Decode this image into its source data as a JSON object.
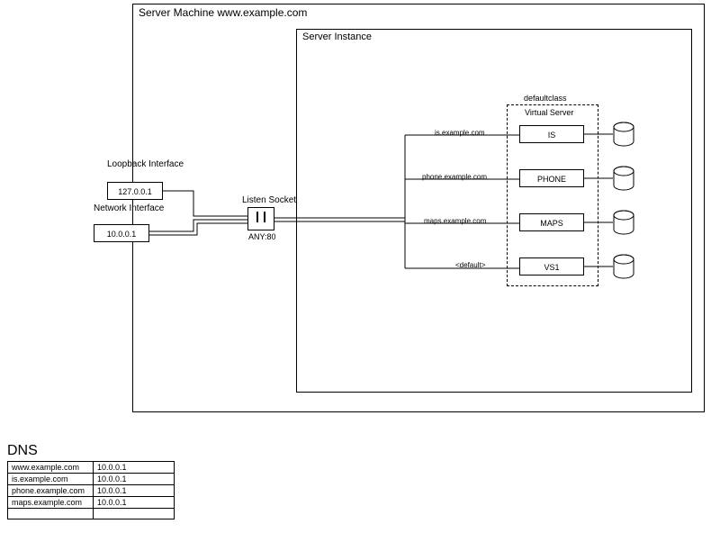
{
  "server_machine": {
    "title": "Server Machine www.example.com"
  },
  "server_instance": {
    "title": "Server Instance"
  },
  "loopback": {
    "label": "Loopback Interface",
    "ip": "127.0.0.1"
  },
  "network": {
    "label": "Network Interface",
    "ip": "10.0.0.1"
  },
  "listen_socket": {
    "label": "Listen Socket",
    "value": "ANY:80"
  },
  "defaultclass": {
    "label": "defaultclass",
    "inner_label": "Virtual Server"
  },
  "vs": [
    {
      "host": "is.example.com",
      "name": "IS"
    },
    {
      "host": "phone.example.com",
      "name": "PHONE"
    },
    {
      "host": "maps.example.com",
      "name": "MAPS"
    },
    {
      "host": "<default>",
      "name": "VS1"
    }
  ],
  "dns": {
    "title": "DNS",
    "rows": [
      {
        "host": "www.example.com",
        "ip": "10.0.0.1"
      },
      {
        "host": "is.example.com",
        "ip": "10.0.0.1"
      },
      {
        "host": "phone.example.com",
        "ip": "10.0.0.1"
      },
      {
        "host": "maps.example.com",
        "ip": "10.0.0.1"
      },
      {
        "host": "",
        "ip": ""
      }
    ]
  }
}
